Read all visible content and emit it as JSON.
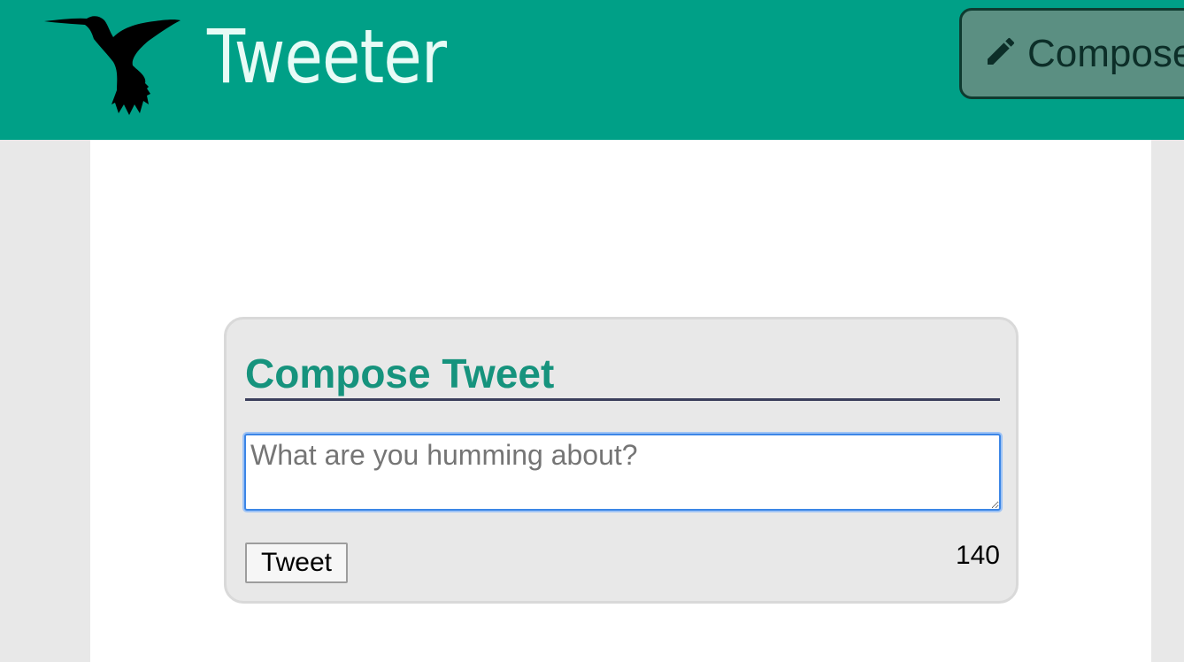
{
  "nav": {
    "brand": "Tweeter",
    "compose_label": "Compose",
    "compose_icon": "pencil-icon",
    "logo_icon": "hummingbird-logo-icon"
  },
  "new_tweet": {
    "heading": "Compose Tweet",
    "textarea_placeholder": "What are you humming about?",
    "textarea_value": "",
    "submit_label": "Tweet",
    "char_count": "140"
  },
  "colors": {
    "nav_bg": "#00a087",
    "brand_text": "#e8fbf6",
    "heading": "#16937d",
    "page_bg": "#e8e8e8"
  }
}
